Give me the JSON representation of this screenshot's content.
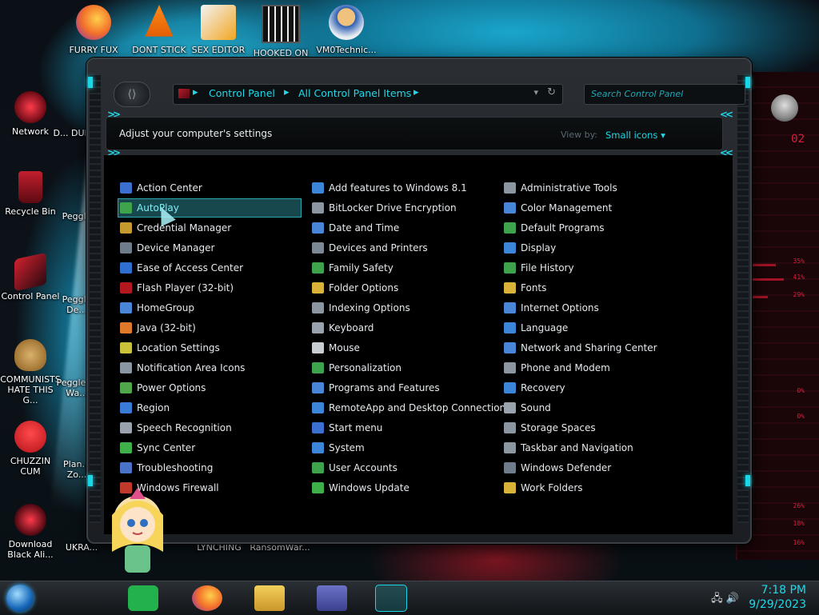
{
  "desktop": {
    "top_icons": [
      {
        "label": "FURRY FUX",
        "icon": "firefox-icon"
      },
      {
        "label": "DONT STICK",
        "icon": "vlc-cone-icon"
      },
      {
        "label": "SEX EDITOR",
        "icon": "hxd-editor-icon"
      },
      {
        "label": "HOOKED ON",
        "icon": "maze-game-icon"
      },
      {
        "label": "VM0Technic...",
        "icon": "doctor-avatar-icon"
      }
    ],
    "left_icons": [
      {
        "label": "Network",
        "icon": "network-globe-icon"
      },
      {
        "label": "D... DUM...",
        "icon": "green-app-icon"
      },
      {
        "label": "Recycle Bin",
        "icon": "recycle-bin-icon"
      },
      {
        "label": "Peggle",
        "icon": "peggle-icon"
      },
      {
        "label": "Control Panel",
        "icon": "control-panel-icon"
      },
      {
        "label": "Peggle De...",
        "icon": "peggle-icon"
      },
      {
        "label": "COMMUNISTS HATE THIS G...",
        "icon": "money-bag-icon"
      },
      {
        "label": "Peggle of Wa...",
        "icon": "peggle-icon"
      },
      {
        "label": "CHUZZIN CUM",
        "icon": "chuzzle-icon"
      },
      {
        "label": "Plan... Zo...",
        "icon": "plants-icon"
      },
      {
        "label": "Download Black Ali...",
        "icon": "alienware-icon"
      },
      {
        "label": "UKRA...",
        "icon": "app-icon"
      }
    ],
    "bottom_labels": [
      "LYNCHING",
      "RansomWar..."
    ]
  },
  "window": {
    "breadcrumb": [
      "Control Panel",
      "All Control Panel Items"
    ],
    "search_placeholder": "Search Control Panel",
    "heading": "Adjust your computer's settings",
    "view_by_label": "View by:",
    "view_by_value": "Small icons ▾",
    "columns": [
      [
        {
          "label": "Action Center",
          "color": "#3b6fd0"
        },
        {
          "label": "AutoPlay",
          "color": "#3fa34d",
          "selected": true
        },
        {
          "label": "Credential Manager",
          "color": "#c59a2e"
        },
        {
          "label": "Device Manager",
          "color": "#6e7c8c"
        },
        {
          "label": "Ease of Access Center",
          "color": "#2f6fcf"
        },
        {
          "label": "Flash Player (32-bit)",
          "color": "#b3181f"
        },
        {
          "label": "HomeGroup",
          "color": "#4a86d8"
        },
        {
          "label": "Java (32-bit)",
          "color": "#e0792a"
        },
        {
          "label": "Location Settings",
          "color": "#c9c23a"
        },
        {
          "label": "Notification Area Icons",
          "color": "#8a96a3"
        },
        {
          "label": "Power Options",
          "color": "#4fa64b"
        },
        {
          "label": "Region",
          "color": "#3b7bd8"
        },
        {
          "label": "Speech Recognition",
          "color": "#9aa3ad"
        },
        {
          "label": "Sync Center",
          "color": "#3db04a"
        },
        {
          "label": "Troubleshooting",
          "color": "#4a72c8"
        },
        {
          "label": "Windows Firewall",
          "color": "#c0392b"
        }
      ],
      [
        {
          "label": "Add features to Windows 8.1",
          "color": "#3b86d8"
        },
        {
          "label": "BitLocker Drive Encryption",
          "color": "#8c96a0"
        },
        {
          "label": "Date and Time",
          "color": "#4a86d8"
        },
        {
          "label": "Devices and Printers",
          "color": "#7c8894"
        },
        {
          "label": "Family Safety",
          "color": "#3fa34d"
        },
        {
          "label": "Folder Options",
          "color": "#d9b23a"
        },
        {
          "label": "Indexing Options",
          "color": "#8c96a0"
        },
        {
          "label": "Keyboard",
          "color": "#9aa3ad"
        },
        {
          "label": "Mouse",
          "color": "#c9ced3"
        },
        {
          "label": "Personalization",
          "color": "#3fa34d"
        },
        {
          "label": "Programs and Features",
          "color": "#4a86d8"
        },
        {
          "label": "RemoteApp and Desktop Connections",
          "color": "#3b86d8"
        },
        {
          "label": "Start menu",
          "color": "#3b6fd0"
        },
        {
          "label": "System",
          "color": "#3b86d8"
        },
        {
          "label": "User Accounts",
          "color": "#3fa34d"
        },
        {
          "label": "Windows Update",
          "color": "#3db04a"
        }
      ],
      [
        {
          "label": "Administrative Tools",
          "color": "#8c96a0"
        },
        {
          "label": "Color Management",
          "color": "#4a86d8"
        },
        {
          "label": "Default Programs",
          "color": "#3fa34d"
        },
        {
          "label": "Display",
          "color": "#3b86d8"
        },
        {
          "label": "File History",
          "color": "#3fa34d"
        },
        {
          "label": "Fonts",
          "color": "#d9b23a"
        },
        {
          "label": "Internet Options",
          "color": "#4a86d8"
        },
        {
          "label": "Language",
          "color": "#3b86d8"
        },
        {
          "label": "Network and Sharing Center",
          "color": "#4a86d8"
        },
        {
          "label": "Phone and Modem",
          "color": "#8c96a0"
        },
        {
          "label": "Recovery",
          "color": "#3b86d8"
        },
        {
          "label": "Sound",
          "color": "#9aa3ad"
        },
        {
          "label": "Storage Spaces",
          "color": "#8c96a0"
        },
        {
          "label": "Taskbar and Navigation",
          "color": "#8c96a0"
        },
        {
          "label": "Windows Defender",
          "color": "#6e7c8c"
        },
        {
          "label": "Work Folders",
          "color": "#d9b23a"
        }
      ]
    ]
  },
  "taskbar": {
    "pinned": [
      "notes-app-icon",
      "firefox-icon",
      "file-explorer-icon",
      "id-card-app-icon",
      "control-panel-icon"
    ],
    "time": "7:18 PM",
    "date": "9/29/2023"
  },
  "hud": {
    "percents": [
      "35%",
      "41%",
      "29%",
      "0%",
      "0%",
      "26%",
      "18%",
      "16%"
    ],
    "top_text": "02"
  }
}
